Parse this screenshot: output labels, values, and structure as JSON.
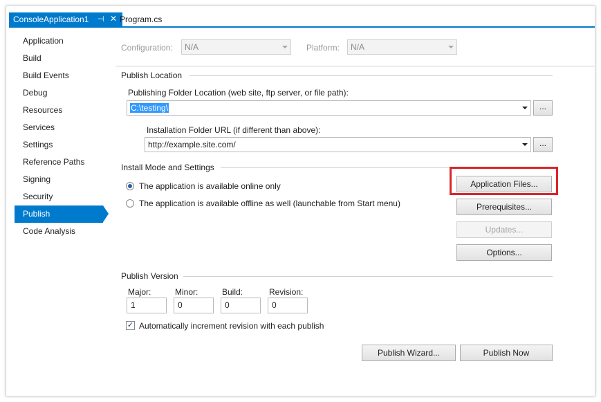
{
  "tabs": {
    "active": {
      "label": "ConsoleApplication1",
      "pin_icon": "pin-icon",
      "close_icon": "close-icon",
      "pin_glyph": "⊣",
      "close_glyph": "✕"
    },
    "inactive": {
      "label": "Program.cs"
    }
  },
  "sidebar": {
    "items": [
      {
        "label": "Application"
      },
      {
        "label": "Build"
      },
      {
        "label": "Build Events"
      },
      {
        "label": "Debug"
      },
      {
        "label": "Resources"
      },
      {
        "label": "Services"
      },
      {
        "label": "Settings"
      },
      {
        "label": "Reference Paths"
      },
      {
        "label": "Signing"
      },
      {
        "label": "Security"
      },
      {
        "label": "Publish"
      },
      {
        "label": "Code Analysis"
      }
    ],
    "selected": "Publish",
    "accent": "#007acc"
  },
  "config": {
    "configuration_label": "Configuration:",
    "configuration_value": "N/A",
    "platform_label": "Platform:",
    "platform_value": "N/A"
  },
  "publish_location": {
    "group_title": "Publish Location",
    "folder_label": "Publishing Folder Location (web site, ftp server, or file path):",
    "folder_value": "C:\\testing\\",
    "browse_label": "...",
    "install_label": "Installation Folder URL (if different than above):",
    "install_value": "http://example.site.com/",
    "install_browse_label": "..."
  },
  "install_mode": {
    "group_title": "Install Mode and Settings",
    "online_label": "The application is available online only",
    "offline_label": "The application is available offline as well (launchable from Start menu)",
    "selected": "online",
    "buttons": {
      "application_files": "Application Files...",
      "prerequisites": "Prerequisites...",
      "updates": "Updates...",
      "options": "Options..."
    },
    "highlight_color": "#d9262b"
  },
  "publish_version": {
    "group_title": "Publish Version",
    "major_label": "Major:",
    "major_value": "1",
    "minor_label": "Minor:",
    "minor_value": "0",
    "build_label": "Build:",
    "build_value": "0",
    "revision_label": "Revision:",
    "revision_value": "0",
    "auto_increment_label": "Automatically increment revision with each publish",
    "auto_increment_checked": true,
    "check_glyph": "✓"
  },
  "actions": {
    "wizard_label": "Publish Wizard...",
    "publish_now_label": "Publish Now"
  }
}
